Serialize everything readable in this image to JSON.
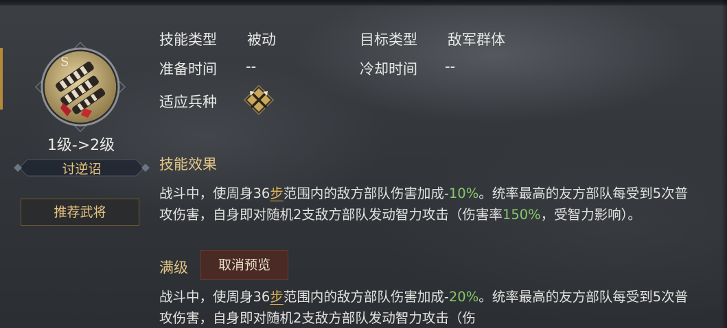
{
  "skill": {
    "level_text": "1级->2级",
    "name": "讨逆诏",
    "recommend_button": "推荐武将"
  },
  "info": {
    "skill_type_label": "技能类型",
    "skill_type_value": "被动",
    "target_type_label": "目标类型",
    "target_type_value": "敌军群体",
    "prep_time_label": "准备时间",
    "prep_time_value": "--",
    "cooldown_label": "冷却时间",
    "cooldown_value": "--",
    "troop_label": "适应兵种",
    "troop_icon": "crossed-weapons-icon"
  },
  "effect": {
    "title": "技能效果",
    "text_a": "战斗中，使周身36",
    "step": "步",
    "text_b": "范围内的敌方部队伤害加成-",
    "pct1": "10%",
    "text_c": "。统率最高的友方部队每受到5次普攻伤害，自身即对随机2支敌方部队发动智力攻击（伤害率",
    "pct2": "150%",
    "text_d": "，受智力影响）。"
  },
  "max_level": {
    "label": "满级",
    "cancel_button": "取消预览",
    "text_a": "战斗中，使周身36",
    "step": "步",
    "text_b": "范围内的敌方部队伤害加成-",
    "pct1": "20%",
    "text_c": "。统率最高的友方部队每受到5次普攻伤害，自身即对随机2支敌方部队发动智力攻击（伤"
  },
  "colors": {
    "gold": "#e2c585",
    "green": "#86c96a",
    "cancel_bg": "#4a2a24"
  }
}
